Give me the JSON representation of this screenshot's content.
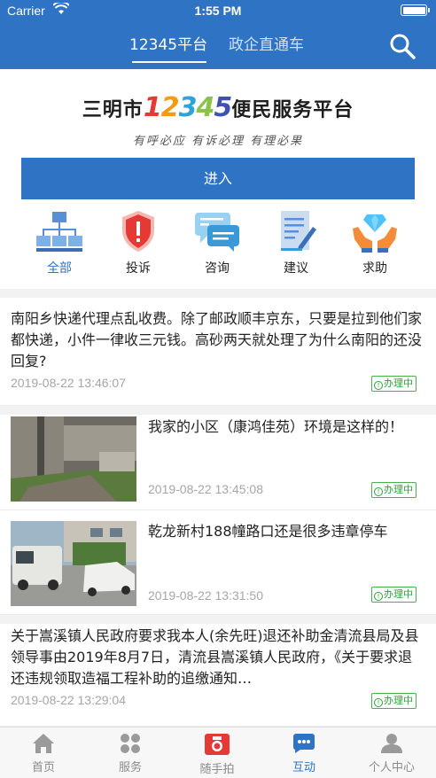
{
  "status_bar": {
    "carrier": "Carrier",
    "time": "1:55 PM"
  },
  "header": {
    "tabs": [
      {
        "label": "12345平台",
        "active": true
      },
      {
        "label": "政企直通车",
        "active": false
      }
    ],
    "accent_color": "#2f73c4"
  },
  "banner": {
    "city": "三明市",
    "number": [
      "1",
      "2",
      "3",
      "4",
      "5"
    ],
    "platform": "便民服务平台",
    "slogan": "有呼必应 有诉必理 有理必果"
  },
  "enter_button": {
    "label": "进入"
  },
  "categories": [
    {
      "label": "全部",
      "icon": "org-chart-icon",
      "active": true
    },
    {
      "label": "投诉",
      "icon": "shield-alert-icon"
    },
    {
      "label": "咨询",
      "icon": "chat-bubbles-icon"
    },
    {
      "label": "建议",
      "icon": "document-pen-icon"
    },
    {
      "label": "求助",
      "icon": "helping-hands-icon"
    }
  ],
  "feed": [
    {
      "text": "南阳乡快递代理点乱收费。除了邮政顺丰京东，只要是拉到他们家都快递，小件一律收三元钱。高砂两天就处理了为什么南阳的还没回复?",
      "date": "2019-08-22 13:46:07",
      "status": "办理中"
    },
    {
      "text": "我家的小区（康鸿佳苑）环境是这样的！",
      "date": "2019-08-22 13:45:08",
      "status": "办理中"
    },
    {
      "text": "乾龙新村188幢路口还是很多违章停车",
      "date": "2019-08-22 13:31:50",
      "status": "办理中"
    },
    {
      "text": "关于嵩溪镇人民政府要求我本人(余先旺)退还补助金清流县局及县领导事由2019年8月7日，清流县嵩溪镇人民政府，《关于要求退还违规领取造福工程补助的追缴通知…",
      "date": "2019-08-22 13:29:04",
      "status": "办理中"
    }
  ],
  "bottom_nav": [
    {
      "label": "首页",
      "icon": "home-icon"
    },
    {
      "label": "服务",
      "icon": "grid-icon"
    },
    {
      "label": "随手拍",
      "icon": "camera-icon"
    },
    {
      "label": "互动",
      "icon": "chat-icon",
      "active": true
    },
    {
      "label": "个人中心",
      "icon": "user-icon"
    }
  ],
  "colors": {
    "primary": "#2f73c4",
    "status_green": "#2e9e3a",
    "badge_border": "#4caf50"
  }
}
